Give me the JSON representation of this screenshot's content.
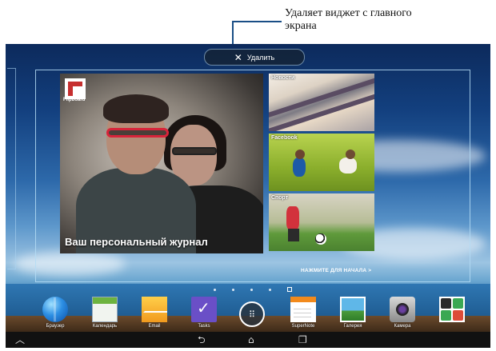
{
  "callout": {
    "line1": "Удаляет виджет с главного",
    "line2": "экрана"
  },
  "delete_bar": {
    "label": "Удалить",
    "icon": "close-icon"
  },
  "widget": {
    "flipboard_brand": "Flipboard",
    "main_caption": "Ваш персональный журнал",
    "tiles": [
      {
        "label": "Новости"
      },
      {
        "label": "Facebook"
      },
      {
        "label": "Спорт"
      }
    ],
    "press_to_start": "НАЖМИТЕ ДЛЯ НАЧАЛА >"
  },
  "page_indicator": {
    "count": 5,
    "active_index": 4
  },
  "dock": [
    {
      "label": "Браузер",
      "icon": "browser-icon"
    },
    {
      "label": "Календарь",
      "icon": "calendar-icon"
    },
    {
      "label": "Email",
      "icon": "email-icon"
    },
    {
      "label": "Tasks",
      "icon": "tasks-icon"
    },
    {
      "label": "",
      "icon": "all-apps-icon"
    },
    {
      "label": "SuperNote",
      "icon": "supernote-icon"
    },
    {
      "label": "Галерея",
      "icon": "gallery-icon"
    },
    {
      "label": "Камера",
      "icon": "camera-icon"
    },
    {
      "label": "",
      "icon": "google-apps-folder-icon"
    }
  ],
  "navbar": {
    "home_up": "︿",
    "back": "⮌",
    "home": "⌂",
    "recents": "❐"
  },
  "colors": {
    "accent": "#1a4e86",
    "widget_frame": "#b4dcf5"
  }
}
